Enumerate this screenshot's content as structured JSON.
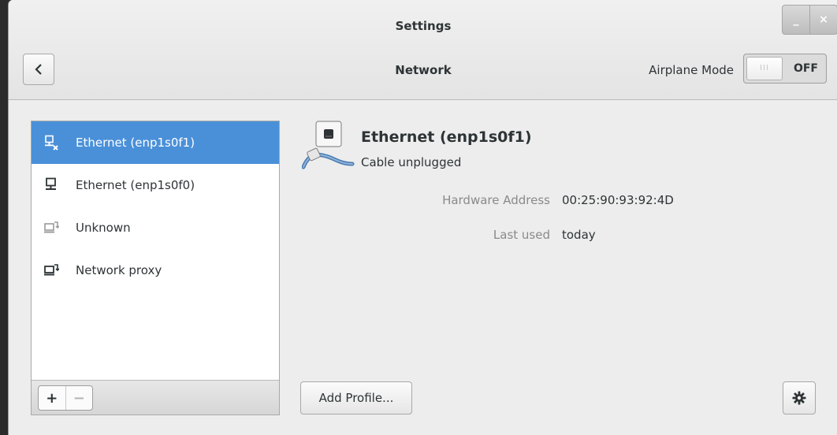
{
  "window": {
    "title": "Settings",
    "minimize_label": "_",
    "close_label": "×"
  },
  "header": {
    "page_title": "Network",
    "airplane_mode_label": "Airplane Mode",
    "airplane_switch_text": "OFF",
    "airplane_knob_text": "III"
  },
  "sidebar": {
    "items": [
      {
        "label": "Ethernet (enp1s0f1)",
        "icon": "network-wired-disconnected-icon",
        "selected": true
      },
      {
        "label": "Ethernet (enp1s0f0)",
        "icon": "network-wired-icon",
        "selected": false
      },
      {
        "label": "Unknown",
        "icon": "network-workgroup-icon",
        "selected": false
      },
      {
        "label": "Network proxy",
        "icon": "network-proxy-icon",
        "selected": false
      }
    ],
    "add_label": "+",
    "remove_label": "−"
  },
  "detail": {
    "device_name": "Ethernet (enp1s0f1)",
    "status": "Cable unplugged",
    "properties": [
      {
        "label": "Hardware Address",
        "value": "00:25:90:93:92:4D"
      },
      {
        "label": "Last used",
        "value": "today"
      }
    ],
    "add_profile_label": "Add Profile...",
    "settings_icon": "gear-icon"
  },
  "colors": {
    "accent": "#4a90d9"
  }
}
